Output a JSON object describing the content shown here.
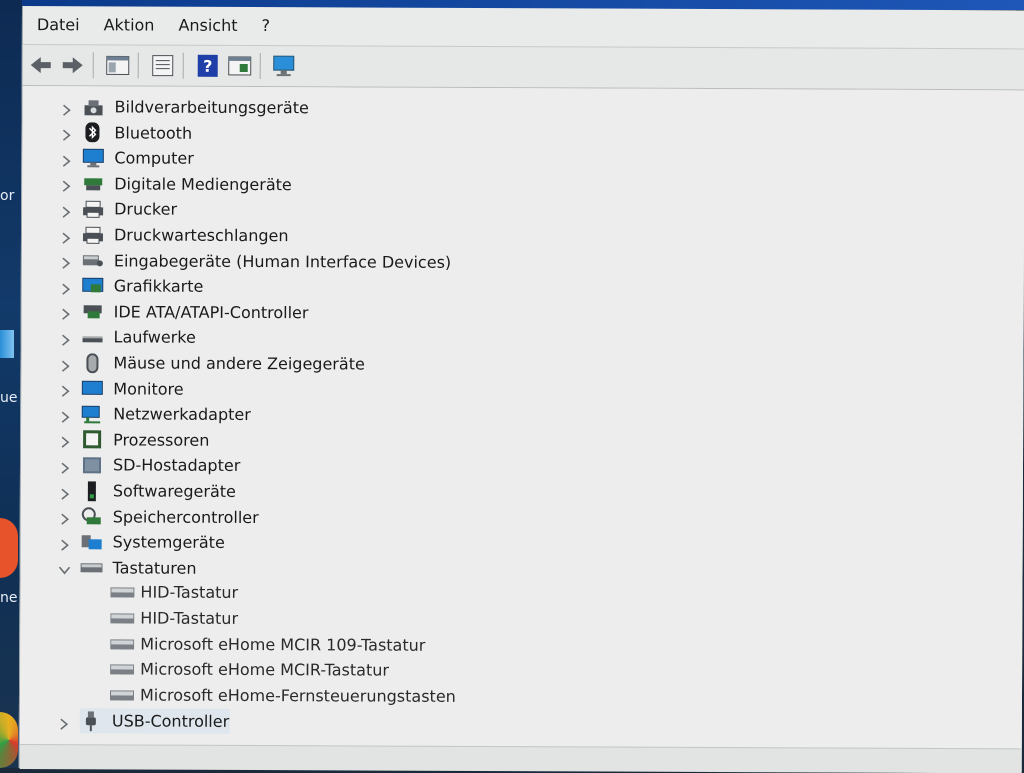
{
  "desktop": {
    "fragments": [
      "or",
      "ue",
      "ne"
    ]
  },
  "menu": {
    "items": [
      "Datei",
      "Aktion",
      "Ansicht",
      "?"
    ]
  },
  "toolbar": {
    "buttons": [
      {
        "name": "back-arrow-icon"
      },
      {
        "name": "forward-arrow-icon"
      },
      {
        "name": "show-hide-tree-icon"
      },
      {
        "name": "properties-icon"
      },
      {
        "name": "help-icon"
      },
      {
        "name": "update-driver-icon"
      },
      {
        "name": "scan-hardware-icon"
      }
    ]
  },
  "tree": {
    "categories": [
      {
        "label": "Bildverarbeitungsgeräte",
        "icon": "camera-icon",
        "expanded": false
      },
      {
        "label": "Bluetooth",
        "icon": "bluetooth-icon",
        "expanded": false
      },
      {
        "label": "Computer",
        "icon": "computer-icon",
        "expanded": false
      },
      {
        "label": "Digitale Mediengeräte",
        "icon": "media-device-icon",
        "expanded": false
      },
      {
        "label": "Drucker",
        "icon": "printer-icon",
        "expanded": false
      },
      {
        "label": "Druckwarteschlangen",
        "icon": "print-queue-icon",
        "expanded": false
      },
      {
        "label": "Eingabegeräte (Human Interface Devices)",
        "icon": "hid-icon",
        "expanded": false
      },
      {
        "label": "Grafikkarte",
        "icon": "display-adapter-icon",
        "expanded": false
      },
      {
        "label": "IDE ATA/ATAPI-Controller",
        "icon": "ide-controller-icon",
        "expanded": false
      },
      {
        "label": "Laufwerke",
        "icon": "disk-drive-icon",
        "expanded": false
      },
      {
        "label": "Mäuse und andere Zeigegeräte",
        "icon": "mouse-icon",
        "expanded": false
      },
      {
        "label": "Monitore",
        "icon": "monitor-icon",
        "expanded": false
      },
      {
        "label": "Netzwerkadapter",
        "icon": "network-adapter-icon",
        "expanded": false
      },
      {
        "label": "Prozessoren",
        "icon": "processor-icon",
        "expanded": false
      },
      {
        "label": "SD-Hostadapter",
        "icon": "sd-host-icon",
        "expanded": false
      },
      {
        "label": "Softwaregeräte",
        "icon": "software-device-icon",
        "expanded": false
      },
      {
        "label": "Speichercontroller",
        "icon": "storage-controller-icon",
        "expanded": false
      },
      {
        "label": "Systemgeräte",
        "icon": "system-device-icon",
        "expanded": false
      },
      {
        "label": "Tastaturen",
        "icon": "keyboard-icon",
        "expanded": true,
        "children": [
          "HID-Tastatur",
          "HID-Tastatur",
          "Microsoft eHome MCIR 109-Tastatur",
          "Microsoft eHome MCIR-Tastatur",
          "Microsoft eHome-Fernsteuerungstasten"
        ]
      },
      {
        "label": "USB-Controller",
        "icon": "usb-icon",
        "expanded": false,
        "selected": true
      }
    ]
  },
  "colors": {
    "icon_blue": "#1e7fd0",
    "icon_green": "#2f7a3a",
    "icon_gray": "#6b7076",
    "selection": "#dfe6ee"
  }
}
